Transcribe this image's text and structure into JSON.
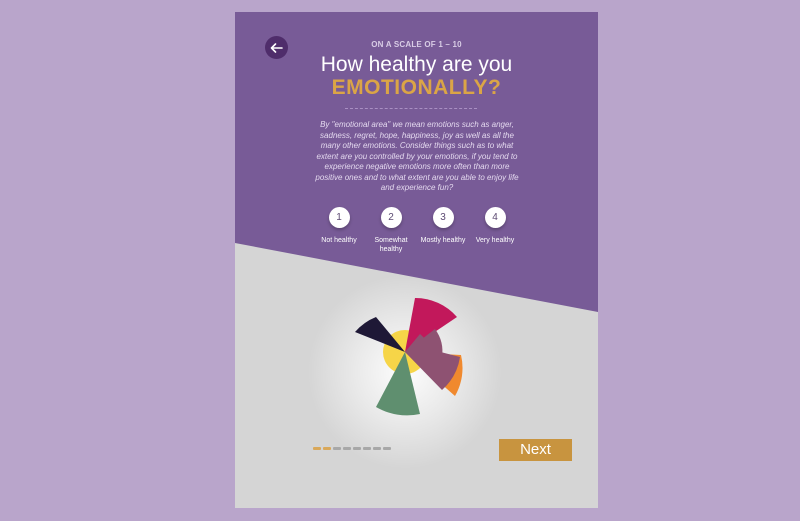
{
  "header": {
    "back_icon": "arrow-left-icon",
    "scale_label": "ON A SCALE OF 1 – 10",
    "question_line1": "How healthy are you",
    "question_line2": "EMOTIONALLY?"
  },
  "description": "By \"emotional area\" we mean emotions such as anger, sadness, regret, hope, happiness, joy as well as all the many other emotions. Consider things such as to what extent are you controlled by your emotions, if you tend to experience negative emotions more often than more positive ones and to what extent are you able to enjoy life and experience fun?",
  "options": [
    {
      "number": "1",
      "label": "Not healthy"
    },
    {
      "number": "2",
      "label": "Somewhat healthy"
    },
    {
      "number": "3",
      "label": "Mostly healthy"
    },
    {
      "number": "4",
      "label": "Very healthy"
    }
  ],
  "wheel": {
    "colors": {
      "crimson": "#c2185b",
      "mauve": "#8e5272",
      "orange": "#f0892e",
      "green": "#5f8f6f",
      "navy": "#1e1836",
      "yellow": "#f6d548"
    }
  },
  "progress": {
    "total_steps": 8,
    "completed_steps": 2,
    "active_color": "#d9a85a",
    "inactive_color": "#a8a8a8"
  },
  "next_label": "Next",
  "colors": {
    "page_background": "#b9a5cb",
    "panel_purple": "#785b97",
    "panel_gray": "#d5d5d5",
    "accent_gold": "#dba546",
    "button_gold": "#c8943f"
  }
}
